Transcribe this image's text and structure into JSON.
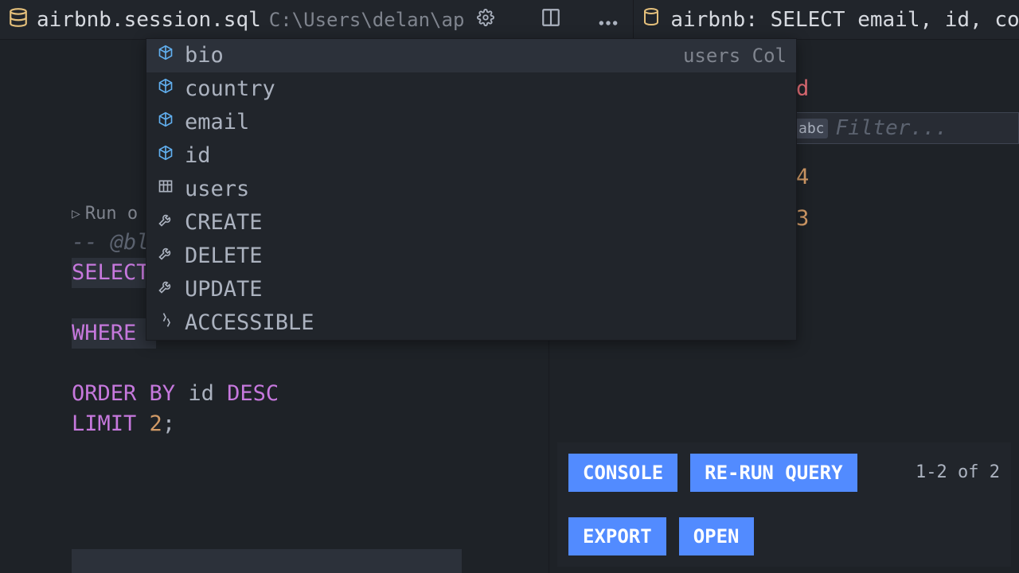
{
  "tabs": {
    "left": {
      "filename": "airbnb.session.sql",
      "path": "C:\\Users\\delan\\ap"
    },
    "right": {
      "title": "airbnb: SELECT email, id, country FROM Use"
    }
  },
  "codelens": {
    "label": "Run o"
  },
  "editor": {
    "comment": "-- @bl",
    "select": "SELECT",
    "where": "WHERE",
    "orderby_kw1": "ORDER",
    "orderby_kw2": "BY",
    "orderby_col": "id",
    "orderby_dir": "DESC",
    "limit_kw": "LIMIT",
    "limit_val": "2",
    "semicolon": ";"
  },
  "autocomplete": {
    "detail": "users Col",
    "items": [
      {
        "icon": "field",
        "label": "bio",
        "selected": true
      },
      {
        "icon": "field",
        "label": "country"
      },
      {
        "icon": "field",
        "label": "email"
      },
      {
        "icon": "field",
        "label": "id"
      },
      {
        "icon": "table",
        "label": "users"
      },
      {
        "icon": "wrench",
        "label": "CREATE"
      },
      {
        "icon": "wrench",
        "label": "DELETE"
      },
      {
        "icon": "wrench",
        "label": "UPDATE"
      },
      {
        "icon": "connector",
        "label": "ACCESSIBLE"
      }
    ]
  },
  "results": {
    "header": "d",
    "filter_placeholder": "Filter...",
    "values": [
      "4",
      "3"
    ],
    "page_info": "1-2 of 2"
  },
  "actions": {
    "console": "CONSOLE",
    "rerun": "RE-RUN QUERY",
    "export": "EXPORT",
    "open": "OPEN"
  }
}
